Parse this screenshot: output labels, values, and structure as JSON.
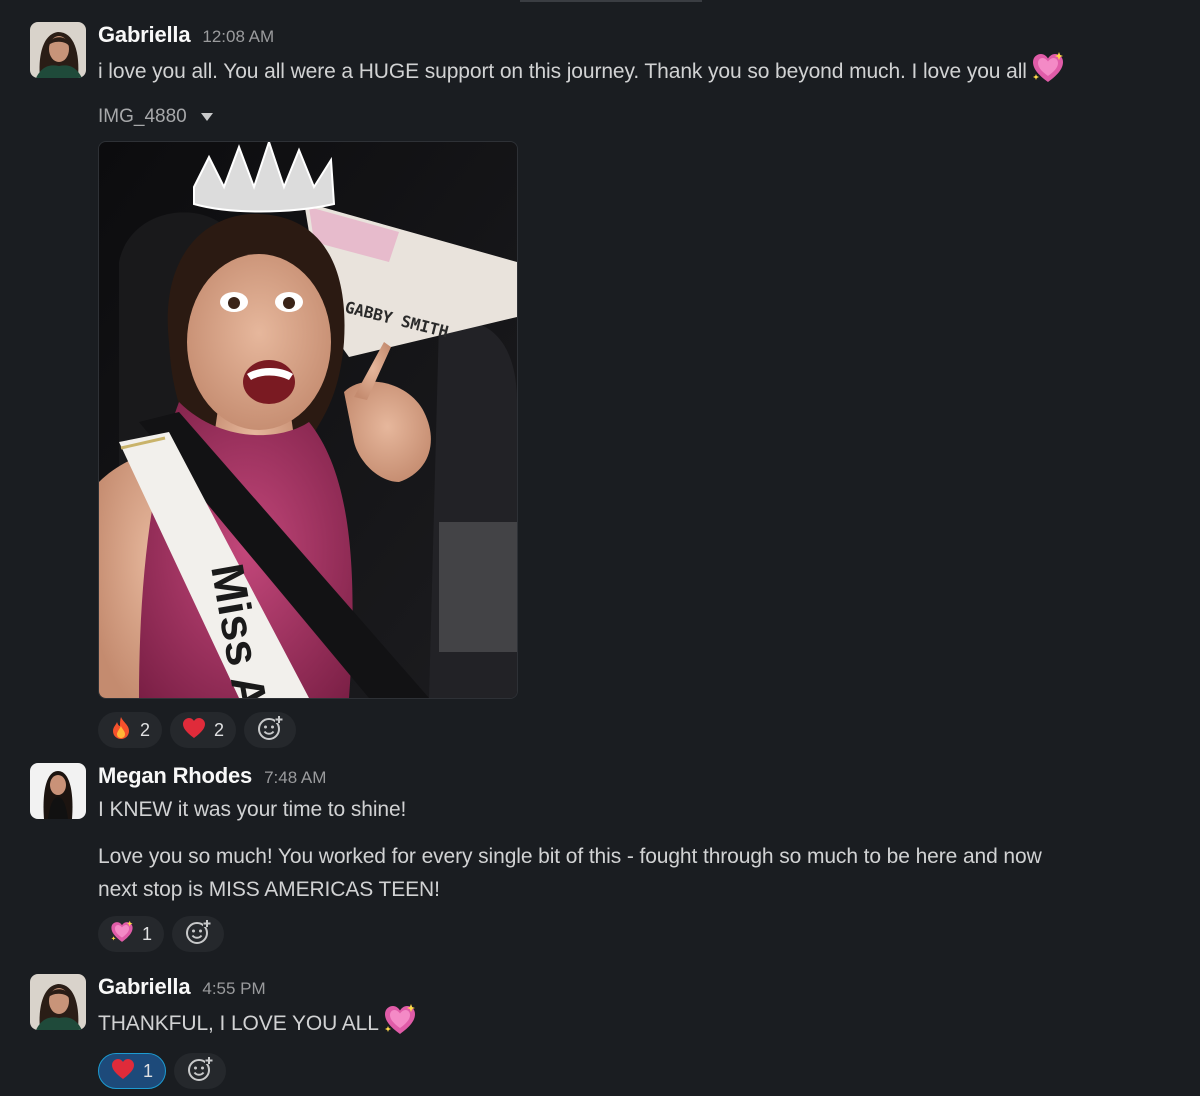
{
  "messages": [
    {
      "author": "Gabriella",
      "time": "12:08 AM",
      "text": "i love you all. You all were a HUGE support on this journey. Thank you so beyond much. I love you all",
      "trailing_emoji": "sparkling-heart",
      "attachment": {
        "name": "IMG_4880",
        "photo_text": {
          "sash": "Miss A",
          "sign": "GABBY SMITH"
        }
      },
      "reactions": [
        {
          "emoji": "fire",
          "count": "2"
        },
        {
          "emoji": "red-heart",
          "count": "2"
        }
      ]
    },
    {
      "author": "Megan Rhodes",
      "time": "7:48 AM",
      "text": "I KNEW it was your time to shine!",
      "text2_line1": "Love you so much! You worked for every single bit of this - fought through so much to be here and now",
      "text2_line2": "next stop is MISS AMERICAS TEEN!",
      "reactions": [
        {
          "emoji": "sparkling-heart",
          "count": "1"
        }
      ]
    },
    {
      "author": "Gabriella",
      "time": "4:55 PM",
      "text": "THANKFUL, I LOVE YOU ALL",
      "trailing_emoji": "sparkling-heart",
      "reactions": [
        {
          "emoji": "red-heart",
          "count": "1",
          "active": true
        }
      ]
    }
  ],
  "colors": {
    "background": "#1a1d21",
    "reaction_bg": "#25282c",
    "active_reaction_bg": "#1d4a7a",
    "active_reaction_border": "#1d9bd1"
  }
}
